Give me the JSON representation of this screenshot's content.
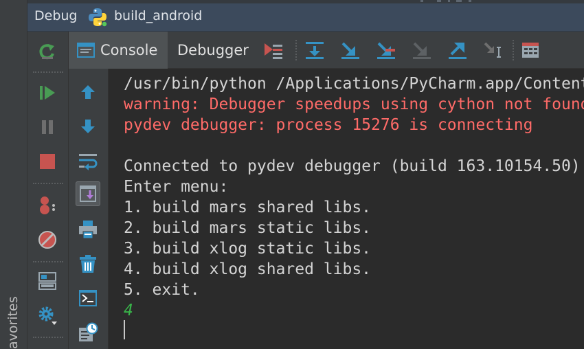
{
  "left_strip": {
    "favorites_label": "avorites"
  },
  "header": {
    "title": "Debug",
    "config_name": "build_android",
    "icon": "python-icon"
  },
  "action_toolbar": [
    {
      "name": "rerun-icon",
      "color": "#499c54"
    },
    {
      "name": "resume-icon",
      "color": "#499c54"
    },
    {
      "name": "pause-icon",
      "color": "#6e6e6e"
    },
    {
      "name": "stop-icon",
      "color": "#c75450"
    },
    {
      "name": "view-breakpoints-icon",
      "color": "#c75450"
    },
    {
      "name": "mute-breakpoints-icon",
      "color": "#c75450"
    },
    {
      "name": "layout-icon",
      "color": "#9aa7b0"
    },
    {
      "name": "settings-icon",
      "color": "#3592c4"
    }
  ],
  "tabs": [
    {
      "label": "Console",
      "active": true,
      "icon": "console-icon"
    },
    {
      "label": "Debugger",
      "active": false
    }
  ],
  "step_toolbar": [
    "show-execution-point-icon",
    "step-over-icon",
    "step-into-icon",
    "step-into-my-code-icon",
    "force-step-into-icon",
    "step-out-icon",
    "run-to-cursor-icon",
    "evaluate-expression-icon"
  ],
  "console_toolbar": [
    "up-arrow-icon",
    "down-arrow-icon",
    "soft-wrap-icon",
    "scroll-to-end-icon",
    "print-icon",
    "clear-all-icon",
    "show-command-line-icon",
    "history-icon"
  ],
  "console": {
    "lines": [
      {
        "text": "/usr/bin/python /Applications/PyCharm.app/Contents/helpers/pydev/pydevd.py",
        "kind": "normal"
      },
      {
        "text": "warning: Debugger speedups using cython not found",
        "kind": "err"
      },
      {
        "text": "pydev debugger: process 15276 is connecting",
        "kind": "err"
      },
      {
        "text": "",
        "kind": "normal"
      },
      {
        "text": "Connected to pydev debugger (build 163.10154.50)",
        "kind": "normal"
      },
      {
        "text": "Enter menu:",
        "kind": "normal"
      },
      {
        "text": "1. build mars shared libs.",
        "kind": "normal"
      },
      {
        "text": "2. build mars static libs.",
        "kind": "normal"
      },
      {
        "text": "3. build xlog static libs.",
        "kind": "normal"
      },
      {
        "text": "4. build xlog shared libs.",
        "kind": "normal"
      },
      {
        "text": "5. exit.",
        "kind": "normal"
      },
      {
        "text": "4",
        "kind": "input"
      }
    ]
  },
  "colors": {
    "accent_blue": "#3592c4",
    "error_text": "#ff6b68",
    "input_text": "#39b54a"
  }
}
